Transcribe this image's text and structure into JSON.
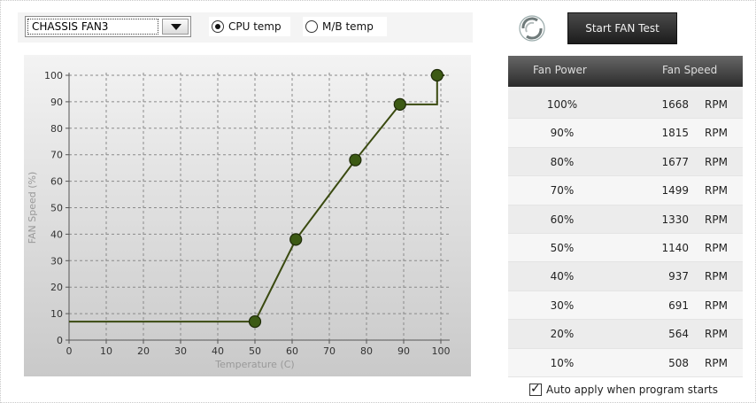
{
  "fan_select": {
    "value": "CHASSIS FAN3"
  },
  "temp_source": {
    "cpu_label": "CPU temp",
    "mb_label": "M/B temp",
    "selected": "cpu"
  },
  "start_button": {
    "label": "Start FAN Test"
  },
  "table": {
    "col_power": "Fan Power",
    "col_speed": "Fan Speed",
    "rows": [
      {
        "power": "100%",
        "speed": "1668",
        "unit": "RPM"
      },
      {
        "power": "90%",
        "speed": "1815",
        "unit": "RPM"
      },
      {
        "power": "80%",
        "speed": "1677",
        "unit": "RPM"
      },
      {
        "power": "70%",
        "speed": "1499",
        "unit": "RPM"
      },
      {
        "power": "60%",
        "speed": "1330",
        "unit": "RPM"
      },
      {
        "power": "50%",
        "speed": "1140",
        "unit": "RPM"
      },
      {
        "power": "40%",
        "speed": "937",
        "unit": "RPM"
      },
      {
        "power": "30%",
        "speed": "691",
        "unit": "RPM"
      },
      {
        "power": "20%",
        "speed": "564",
        "unit": "RPM"
      },
      {
        "power": "10%",
        "speed": "508",
        "unit": "RPM"
      }
    ]
  },
  "auto_apply": {
    "label": "Auto apply when program starts",
    "checked": true
  },
  "chart_data": {
    "type": "line",
    "xlabel": "Temperature (C)",
    "ylabel": "FAN Speed (%)",
    "xlim": [
      0,
      100
    ],
    "ylim": [
      0,
      100
    ],
    "xticks": [
      0,
      10,
      20,
      30,
      40,
      50,
      60,
      70,
      80,
      90,
      100
    ],
    "yticks": [
      0,
      10,
      20,
      30,
      40,
      50,
      60,
      70,
      80,
      90,
      100
    ],
    "grid": true,
    "line_color": "#3a4a10",
    "marker_color": "#3c5a14",
    "line_points": [
      [
        0,
        7
      ],
      [
        50,
        7
      ],
      [
        61,
        38
      ],
      [
        77,
        68
      ],
      [
        89,
        89
      ],
      [
        99,
        89
      ],
      [
        99,
        100
      ],
      [
        101,
        100
      ]
    ],
    "control_points": [
      [
        50,
        7
      ],
      [
        61,
        38
      ],
      [
        77,
        68
      ],
      [
        89,
        89
      ],
      [
        99,
        100
      ]
    ]
  }
}
